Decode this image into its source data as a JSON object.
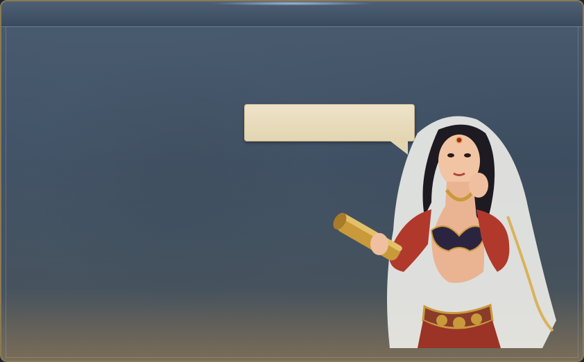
{
  "dialog": {
    "speech_text": "",
    "character_name": ""
  },
  "colors": {
    "panel_background": "#3d4d60",
    "frame_border": "#8c7a55",
    "speech_bubble": "#e3d5b2",
    "veil": "#f2f2f0",
    "dress_red": "#b0392c",
    "gold": "#c89a3a"
  },
  "icons": {
    "character": "advisor-portrait-icon",
    "scroll": "scroll-icon"
  }
}
